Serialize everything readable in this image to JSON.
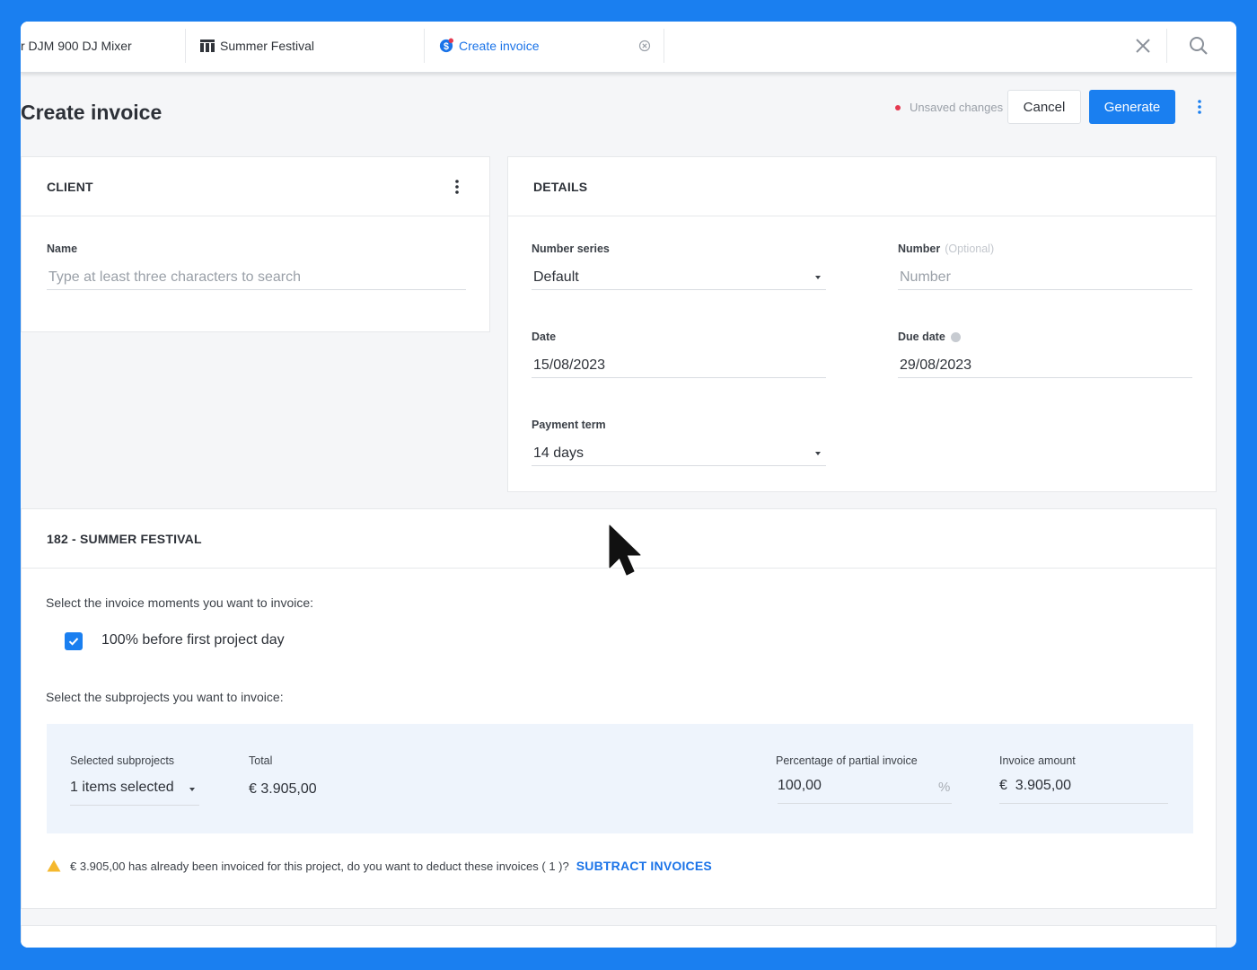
{
  "tabs": [
    {
      "label": "r DJM 900 DJ Mixer"
    },
    {
      "label": "Summer Festival",
      "icon": "calendar-grid-icon"
    },
    {
      "label": "Create invoice",
      "icon": "invoice-dollar-icon",
      "active": true
    }
  ],
  "header": {
    "title": "Create invoice",
    "unsaved_label": "Unsaved changes",
    "cancel_label": "Cancel",
    "generate_label": "Generate"
  },
  "client": {
    "heading": "CLIENT",
    "name_label": "Name",
    "name_placeholder": "Type at least three characters to search"
  },
  "details": {
    "heading": "DETAILS",
    "number_series_label": "Number series",
    "number_series_value": "Default",
    "number_label": "Number",
    "number_optional": "(Optional)",
    "number_placeholder": "Number",
    "date_label": "Date",
    "date_value": "15/08/2023",
    "due_date_label": "Due date",
    "due_date_value": "29/08/2023",
    "payment_term_label": "Payment term",
    "payment_term_value": "14 days"
  },
  "project": {
    "heading": "182 - SUMMER FESTIVAL",
    "moments_prompt": "Select the invoice moments you want to invoice:",
    "moment_label": "100% before first project day",
    "moment_checked": true,
    "subprojects_prompt": "Select the subprojects you want to invoice:",
    "selected_subprojects_label": "Selected subprojects",
    "selected_subprojects_value": "1 items selected",
    "total_label": "Total",
    "total_value": "€ 3.905,00",
    "percentage_label": "Percentage of partial invoice",
    "percentage_value": "100,00",
    "percent_sign": "%",
    "invoice_amount_label": "Invoice amount",
    "invoice_amount_value": "€  3.905,00",
    "warning_text": "€ 3.905,00 has already been invoiced for this project, do you want to deduct these invoices ( 1 )?",
    "warning_link": "SUBTRACT INVOICES"
  },
  "colors": {
    "accent": "#1a7ff0",
    "unsaved_dot": "#e53950",
    "warning": "#f5b82e"
  }
}
